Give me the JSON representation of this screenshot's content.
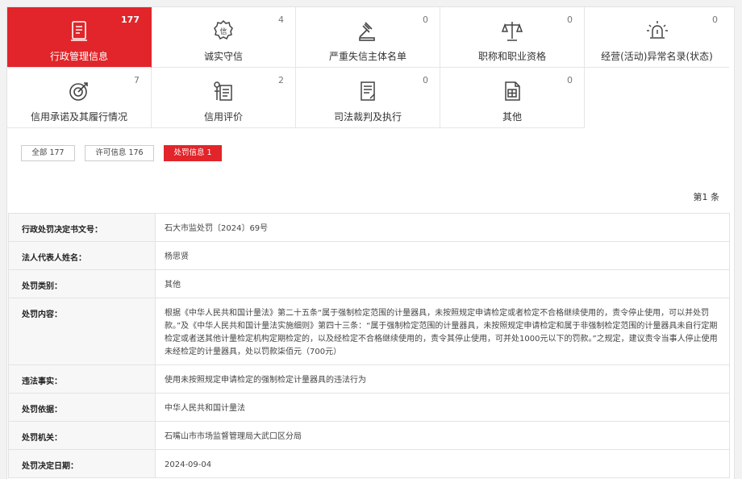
{
  "categories": [
    {
      "label": "行政管理信息",
      "count": "177",
      "icon": "document-list-icon",
      "active": true
    },
    {
      "label": "诚实守信",
      "count": "4",
      "icon": "integrity-badge-icon",
      "active": false
    },
    {
      "label": "严重失信主体名单",
      "count": "0",
      "icon": "gavel-icon",
      "active": false
    },
    {
      "label": "职称和职业资格",
      "count": "0",
      "icon": "scales-icon",
      "active": false
    },
    {
      "label": "经营(活动)异常名录(状态)",
      "count": "0",
      "icon": "alarm-light-icon",
      "active": false
    },
    {
      "label": "信用承诺及其履行情况",
      "count": "7",
      "icon": "target-icon",
      "active": false
    },
    {
      "label": "信用评价",
      "count": "2",
      "icon": "evaluation-icon",
      "active": false
    },
    {
      "label": "司法裁判及执行",
      "count": "0",
      "icon": "judgment-document-icon",
      "active": false
    },
    {
      "label": "其他",
      "count": "0",
      "icon": "other-document-icon",
      "active": false
    }
  ],
  "filters": [
    {
      "label": "全部 177",
      "active": false
    },
    {
      "label": "许可信息 176",
      "active": false
    },
    {
      "label": "处罚信息 1",
      "active": true
    }
  ],
  "page_label": "第1 条",
  "record": [
    {
      "key": "行政处罚决定书文号：",
      "value": "石大市监处罚〔2024〕69号"
    },
    {
      "key": "法人代表人姓名：",
      "value": "杨思贤"
    },
    {
      "key": "处罚类别：",
      "value": "其他"
    },
    {
      "key": "处罚内容：",
      "value": "根据《中华人民共和国计量法》第二十五条“属于强制检定范围的计量器具，未按照规定申请检定或者检定不合格继续使用的，责令停止使用，可以并处罚款。”及《中华人民共和国计量法实施细则》第四十三条：“属于强制检定范围的计量器具，未按照规定申请检定和属于非强制检定范围的计量器具未自行定期检定或者送其他计量检定机构定期检定的，以及经检定不合格继续使用的，责令其停止使用，可并处1000元以下的罚款。”之规定，建议责令当事人停止使用未经检定的计量器具，处以罚款柒佰元（700元）"
    },
    {
      "key": "违法事实：",
      "value": "使用未按照规定申请检定的强制检定计量器具的违法行为"
    },
    {
      "key": "处罚依据：",
      "value": "中华人民共和国计量法"
    },
    {
      "key": "处罚机关：",
      "value": "石嘴山市市场监督管理局大武口区分局"
    },
    {
      "key": "处罚决定日期：",
      "value": "2024-09-04"
    }
  ],
  "colors": {
    "accent": "#e1252a",
    "label_bg": "#f7f7f7",
    "border": "#e3e3e3"
  }
}
